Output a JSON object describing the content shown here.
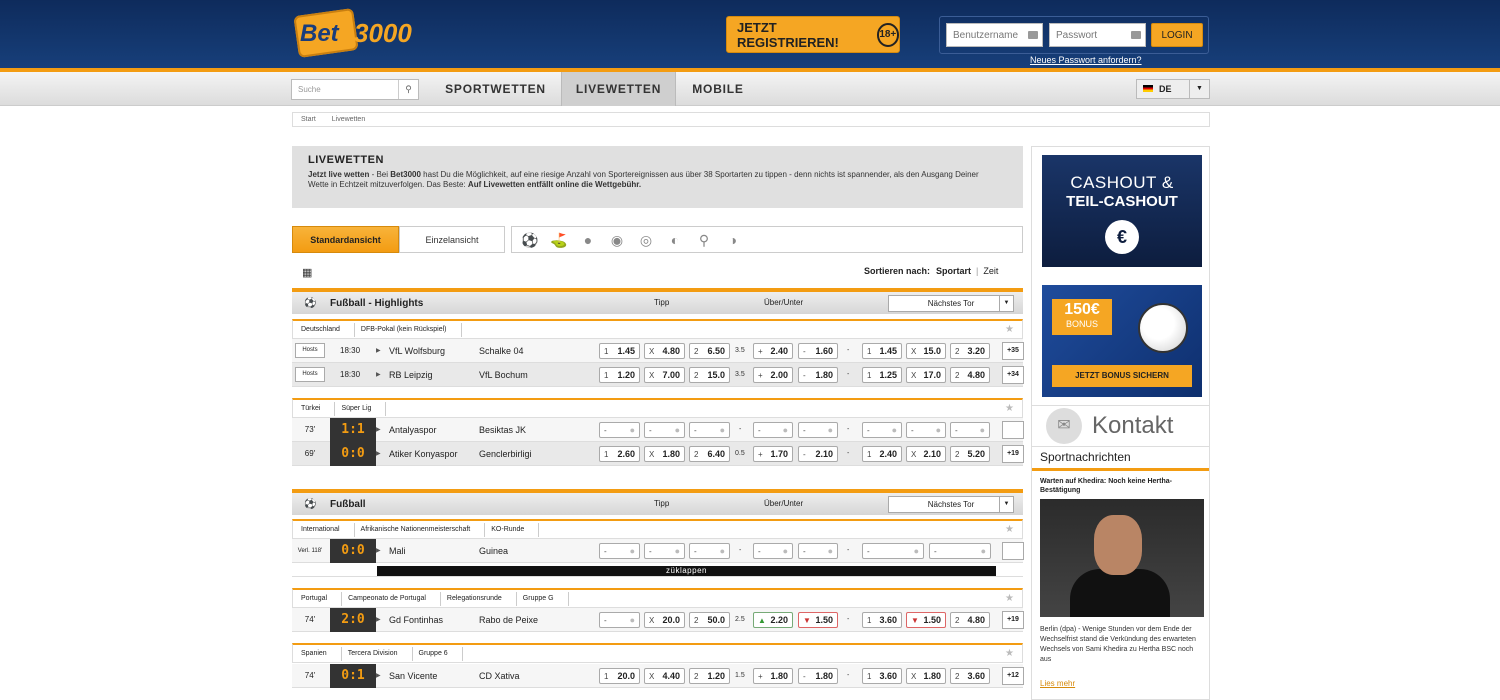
{
  "brand": {
    "logo_a": "Bet",
    "logo_b": "3000"
  },
  "header": {
    "register": "JETZT REGISTRIEREN!",
    "age": "18+",
    "username_ph": "Benutzername",
    "password_ph": "Passwort",
    "login": "LOGIN",
    "forgot": "Neues Passwort anfordern?"
  },
  "nav": {
    "search_ph": "Suche",
    "items": [
      "SPORTWETTEN",
      "LIVEWETTEN",
      "MOBILE"
    ],
    "lang": "DE"
  },
  "crumbs": [
    "Start",
    "Livewetten"
  ],
  "intro": {
    "title": "LIVEWETTEN",
    "text_a": "Jetzt live wetten",
    "text_b": " - Bei ",
    "text_c": "Bet3000",
    "text_d": " hast Du die Möglichkeit, auf eine riesige Anzahl von Sportereignissen aus über 38 Sportarten zu tippen - denn nichts ist spannender, als den Ausgang Deiner Wette in Echtzeit mitzuverfolgen. Das Beste: ",
    "text_e": "Auf Livewetten entfällt online die Wettgebühr."
  },
  "views": {
    "standard": "Standardansicht",
    "single": "Einzelansicht"
  },
  "sort": {
    "label": "Sortieren nach:",
    "sport": "Sportart",
    "time": "Zeit"
  },
  "sections": [
    {
      "title": "Fußball - Highlights",
      "tipp": "Tipp",
      "ou": "Über/Unter",
      "select": "Nächstes Tor"
    },
    {
      "title": "Fußball",
      "tipp": "Tipp",
      "ou": "Über/Unter",
      "select": "Nächstes Tor"
    }
  ],
  "leagues": {
    "l1": [
      "Deutschland",
      "DFB-Pokal (kein Rückspiel)"
    ],
    "l2": [
      "Türkei",
      "Süper Lig"
    ],
    "l3": [
      "International",
      "Afrikanische Nationenmeisterschaft",
      "KO-Runde"
    ],
    "l4": [
      "Portugal",
      "Campeonato de Portugal",
      "Relegationsrunde",
      "Gruppe G"
    ],
    "l5": [
      "Spanien",
      "Tercera Division",
      "Gruppe 6"
    ]
  },
  "matches": {
    "m1": {
      "btn": "Hosts",
      "clock": "18:30",
      "home": "VfL Wolfsburg",
      "away": "Schalke 04",
      "o1": "1.45",
      "ox": "4.80",
      "o2": "6.50",
      "line": "3.5",
      "over": "2.40",
      "under": "1.60",
      "n1": "1.45",
      "nx": "15.0",
      "n2": "3.20",
      "more": "+35"
    },
    "m2": {
      "btn": "Hosts",
      "clock": "18:30",
      "home": "RB Leipzig",
      "away": "VfL Bochum",
      "o1": "1.20",
      "ox": "7.00",
      "o2": "15.0",
      "line": "3.5",
      "over": "2.00",
      "under": "1.80",
      "n1": "1.25",
      "nx": "17.0",
      "n2": "4.80",
      "more": "+34"
    },
    "m3": {
      "time": "73'",
      "score": "1:1",
      "home": "Antalyaspor",
      "away": "Besiktas JK"
    },
    "m4": {
      "time": "69'",
      "score": "0:0",
      "home": "Atiker Konyaspor",
      "away": "Genclerbirligi",
      "o1": "2.60",
      "ox": "1.80",
      "o2": "6.40",
      "line": "0.5",
      "over": "1.70",
      "under": "2.10",
      "n1": "2.40",
      "nx": "2.10",
      "n2": "5.20",
      "more": "+19"
    },
    "m5": {
      "time": "Verl. 118'",
      "score": "0:0",
      "home": "Mali",
      "away": "Guinea"
    },
    "m6": {
      "time": "74'",
      "score": "2:0",
      "home": "Gd Fontinhas",
      "away": "Rabo de Peixe",
      "ox": "20.0",
      "o2": "50.0",
      "line": "2.5",
      "over": "2.20",
      "under": "1.50",
      "n1": "3.60",
      "nx": "1.50",
      "n2": "4.80",
      "more": "+19"
    },
    "m7": {
      "time": "74'",
      "score": "0:1",
      "home": "San Vicente",
      "away": "CD Xativa",
      "o1": "20.0",
      "ox": "4.40",
      "o2": "1.20",
      "line": "1.5",
      "over": "1.80",
      "under": "1.80",
      "n1": "3.60",
      "nx": "1.80",
      "n2": "3.60",
      "more": "+12"
    }
  },
  "collapse": "züklappen",
  "side": {
    "cash1": "CASHOUT &",
    "cash2": "TEIL-CASHOUT",
    "bonus_amt": "150€",
    "bonus_word": "BONUS",
    "bonus_cta": "JETZT BONUS SICHERN",
    "kontakt": "Kontakt",
    "news_head": "Sportnachrichten",
    "news_title": "Warten auf Khedira: Noch keine Hertha-Bestätigung",
    "news_text": "Berlin (dpa) - Wenige Stunden vor dem Ende der Wechselfrist stand die Verkündung des erwarteten Wechsels von Sami Khedira zu Hertha BSC noch aus",
    "news_more": "Lies mehr"
  }
}
